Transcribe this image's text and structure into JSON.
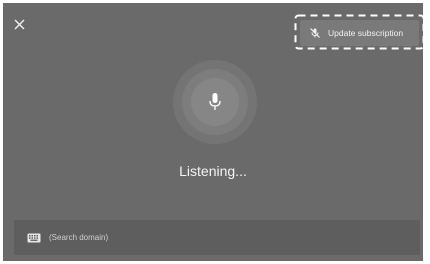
{
  "header": {
    "close_icon": "close-icon",
    "update_button": {
      "icon": "mic-off-icon",
      "label": "Update subscription"
    }
  },
  "voice": {
    "mic_icon": "microphone-icon",
    "status": "Listening..."
  },
  "search": {
    "icon": "keyboard-icon",
    "placeholder": "(Search domain)"
  },
  "colors": {
    "background": "#6a6a6a",
    "button": "#7a7a7a",
    "search_bar": "#5e5e5e",
    "text": "#f4f4f4"
  }
}
